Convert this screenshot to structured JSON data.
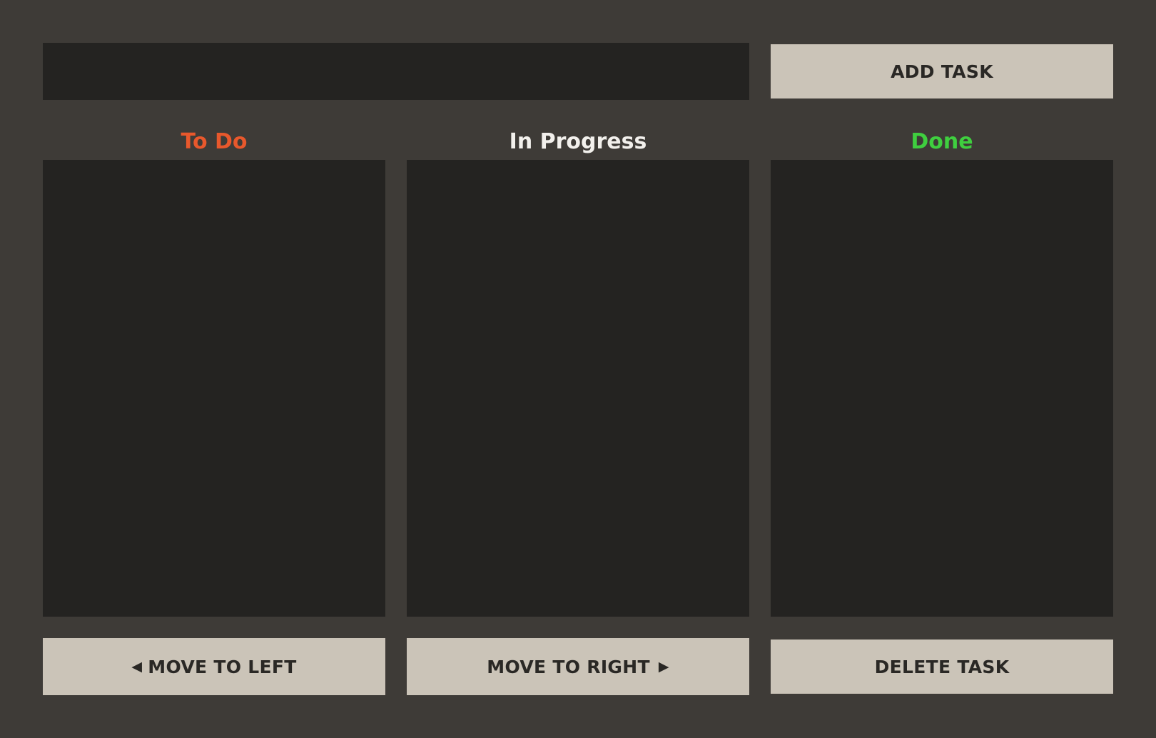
{
  "input": {
    "value": "",
    "placeholder": ""
  },
  "buttons": {
    "add_task": "ADD TASK",
    "move_left": "MOVE TO LEFT",
    "move_left_icon": "◀",
    "move_right": "MOVE TO RIGHT",
    "move_right_icon": "▶",
    "delete_task": "DELETE TASK"
  },
  "columns": [
    {
      "title": "To Do",
      "color": "#e8582c",
      "tasks": []
    },
    {
      "title": "In Progress",
      "color": "#f2f0ec",
      "tasks": []
    },
    {
      "title": "Done",
      "color": "#3fcf3f",
      "tasks": []
    }
  ],
  "colors": {
    "background": "#3e3b37",
    "panel": "#242321",
    "button": "#cbc4b8",
    "button_text": "#2a2825"
  }
}
